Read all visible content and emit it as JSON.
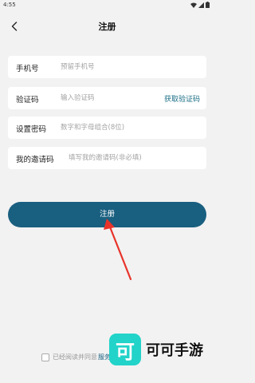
{
  "status_bar": {
    "time": "4:55"
  },
  "header": {
    "title": "注册",
    "back_icon": "chevron-left-icon"
  },
  "form": {
    "phone": {
      "label": "手机号",
      "placeholder": "预留手机号",
      "value": ""
    },
    "code": {
      "label": "验证码",
      "placeholder": "输入验证码",
      "value": "",
      "get_code_label": "获取验证码"
    },
    "password": {
      "label": "设置密码",
      "placeholder": "数字和字母组合(8位)",
      "value": ""
    },
    "invite": {
      "label": "我的邀请码",
      "placeholder": "填写我的邀请码(非必填)",
      "value": ""
    }
  },
  "register_button": {
    "label": "注册"
  },
  "agreement": {
    "text": "已经阅读并同意",
    "link": "服务协议",
    "checked": false
  },
  "watermark": {
    "logo_char": "可",
    "text": "可可手游"
  },
  "colors": {
    "accent": "#195f80",
    "link": "#1c6f86",
    "background": "#f2f2f2",
    "arrow": "#e8332a",
    "watermark": "#22d3c9"
  }
}
